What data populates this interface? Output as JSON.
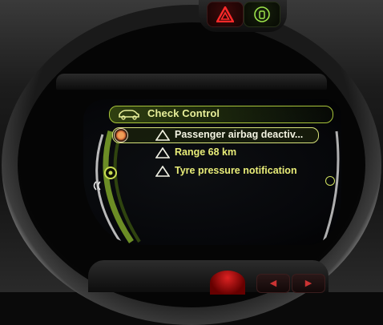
{
  "screen": {
    "header": {
      "title": "Check Control",
      "icon": "car-check-icon"
    },
    "messages": [
      {
        "text": "Passenger airbag deactiv...",
        "icon": "warning-triangle-icon",
        "selected": true
      },
      {
        "text": "Range 68 km",
        "icon": "warning-triangle-icon",
        "selected": false
      },
      {
        "text": "Tyre pressure notification",
        "icon": "warning-triangle-icon",
        "selected": false
      }
    ]
  },
  "colors": {
    "accent": "#a8c43a",
    "message_text": "#e8ec78",
    "selected_text": "#f4f4e2",
    "hazard": "#e02020"
  }
}
